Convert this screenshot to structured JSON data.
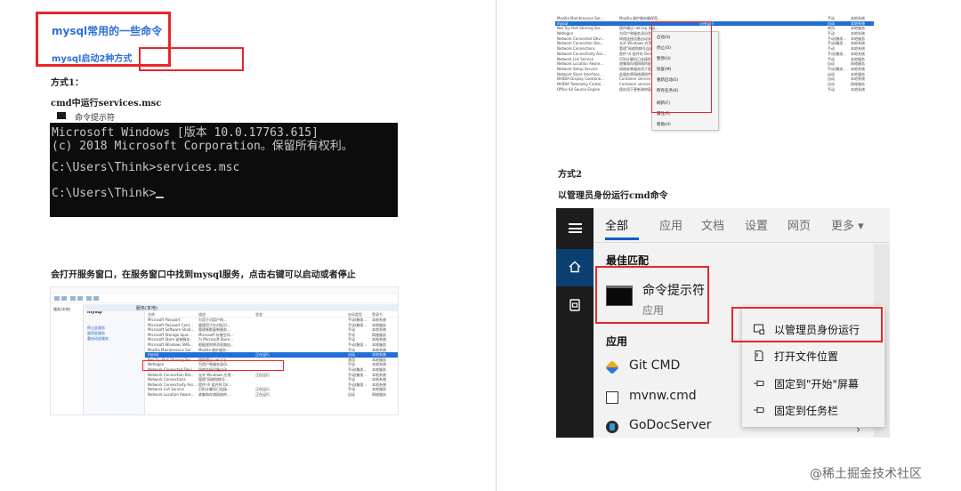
{
  "left_page": {
    "title": "mysql常用的一些命令",
    "subtitle": "mysql启动2种方式",
    "method1_heading": "方式1：",
    "method1_step": "cmd中运行services.msc",
    "cmd": {
      "window_title": "命令提示符",
      "line1": "Microsoft Windows [版本 10.0.17763.615]",
      "line2": "(c) 2018 Microsoft Corporation。保留所有权利。",
      "prompt1": "C:\\Users\\Think>",
      "command": "services.msc",
      "prompt2": "C:\\Users\\Think>"
    },
    "instruction": "会打开服务窗口，在服务窗口中找到mysql服务，点击右键可以启动或者停止",
    "services_window": {
      "tree_label": "服务(本地)",
      "tab_label": "服务(本地)",
      "selected_name": "mysql",
      "links": [
        "停止此服务",
        "暂停此服务",
        "重启动此服务"
      ],
      "columns": [
        "名称",
        "描述",
        "状态",
        "启动类型",
        "登录为"
      ],
      "rows": [
        [
          "Microsoft Passport",
          "为用于对用户的...",
          "",
          "手动(触发...",
          "本地系统"
        ],
        [
          "Microsoft Passport Cont...",
          "管理用于针对标识...",
          "",
          "手动(触发...",
          "本地服务"
        ],
        [
          "Microsoft Software Shad...",
          "管理卷影复制服务...",
          "",
          "手动",
          "本地系统"
        ],
        [
          "Microsoft Storage Spac...",
          "Microsoft 存储空间...",
          "",
          "手动",
          "网络服务"
        ],
        [
          "Microsoft Store 安装服务",
          "为 Microsoft Store...",
          "",
          "手动",
          "本地系统"
        ],
        [
          "Microsoft Windows SMS...",
          "根据规则将消息路由...",
          "",
          "手动(触发...",
          "本地服务"
        ],
        [
          "Mozilla Maintenance Ser...",
          "Mozilla 维护服务...",
          "",
          "手动",
          "本地系统"
        ],
        [
          "mysql",
          "",
          "正在运行",
          "自动",
          "本地系统"
        ],
        [
          "Net.Tcp Port Sharing Ser...",
          "提供通过 net.tcp...",
          "",
          "禁用",
          "本地服务"
        ],
        [
          "Netlogon",
          "为用户和服务身份...",
          "",
          "手动",
          "本地系统"
        ],
        [
          "Network Connected Devi...",
          "网络连接设备自动...",
          "",
          "手动(触发...",
          "本地服务"
        ],
        [
          "Network Connection Bro...",
          "允许 Windows 应用...",
          "正在运行",
          "手动(触发...",
          "本地系统"
        ],
        [
          "Network Connections",
          "管理\"网络和拨号...",
          "",
          "手动",
          "本地系统"
        ],
        [
          "Network Connectivity Ass...",
          "提供 UI 组件的 Dir...",
          "",
          "手动(触发...",
          "本地系统"
        ],
        [
          "Network List Service",
          "识别计算机已连接...",
          "正在运行",
          "手动",
          "本地服务"
        ],
        [
          "Network Location Aware...",
          "收集和存储网络的...",
          "正在运行",
          "自动",
          "网络服务"
        ]
      ]
    }
  },
  "right_page": {
    "services_top": {
      "rows": [
        [
          "Mozilla Maintenance Ser...",
          "Mozilla 维护服务确保您...",
          "",
          "手动",
          "本地系统"
        ],
        [
          "mysql",
          "",
          "正在运行",
          "自动",
          "本地系统"
        ],
        [
          "Net.Tcp Port Sharing Ser...",
          "提供通过 net.tcp 协议...",
          "",
          "禁用",
          "本地服务"
        ],
        [
          "Netlogon",
          "为用户和服务身份验证...",
          "",
          "手动",
          "本地系统"
        ],
        [
          "Network Connected Devi...",
          "网络连接设备自动安装...",
          "",
          "手动(触发...",
          "本地服务"
        ],
        [
          "Network Connection Bro...",
          "允许 Windows 应用从...",
          "正在运行",
          "手动(触发...",
          "本地系统"
        ],
        [
          "Network Connections",
          "管理\"网络和拨号连接\"...",
          "",
          "手动",
          "本地系统"
        ],
        [
          "Network Connectivity Ass...",
          "提供 UI 组件的 DirectA...",
          "",
          "手动(触发...",
          "本地系统"
        ],
        [
          "Network List Service",
          "识别计算机已连接的网...",
          "正在运行",
          "手动",
          "本地服务"
        ],
        [
          "Network Location Aware...",
          "收集和存储网络的配置...",
          "正在运行",
          "自动",
          "网络服务"
        ],
        [
          "Network Setup Service",
          "网络安装服务用于管理...",
          "",
          "手动(触发...",
          "本地系统"
        ],
        [
          "Network Store Interface ...",
          "此服务将网络通知传递...",
          "正在运行",
          "自动",
          "本地服务"
        ],
        [
          "NVIDIA Display Containe...",
          "Container service for...",
          "正在运行",
          "自动",
          "本地系统"
        ],
        [
          "NVIDIA Telemetry Contai...",
          "Container service for NVIDIA Tel...",
          "正在运行",
          "自动",
          "网络服务"
        ],
        [
          "Office 64 Source Engine",
          "保存用于更新和修复安装文件...",
          "",
          "手动",
          "本地系统"
        ]
      ],
      "context_menu": [
        "启动(S)",
        "停止(O)",
        "暂停(U)",
        "恢复(M)",
        "重新启动(E)",
        "所有任务(K)",
        "刷新(F)",
        "属性(R)",
        "帮助(H)"
      ]
    },
    "method2_heading": "方式2",
    "method2_step": "以管理员身份运行cmd命令",
    "search": {
      "tabs": [
        "全部",
        "应用",
        "文档",
        "设置",
        "网页",
        "更多 ▾"
      ],
      "best_match_label": "最佳匹配",
      "best_match_name": "命令提示符",
      "best_match_type": "应用",
      "apps_label": "应用",
      "apps": [
        "Git CMD",
        "mvnw.cmd",
        "GoDocServer"
      ],
      "chevron": "›"
    },
    "context_menu": [
      "以管理员身份运行",
      "打开文件位置",
      "固定到\"开始\"屏幕",
      "固定到任务栏"
    ]
  },
  "watermark": "@稀土掘金技术社区",
  "colors": {
    "highlight": "#e8262b",
    "title_blue": "#2e6fd8",
    "selection_blue": "#1f6fd6",
    "accent": "#0b5cc9"
  }
}
